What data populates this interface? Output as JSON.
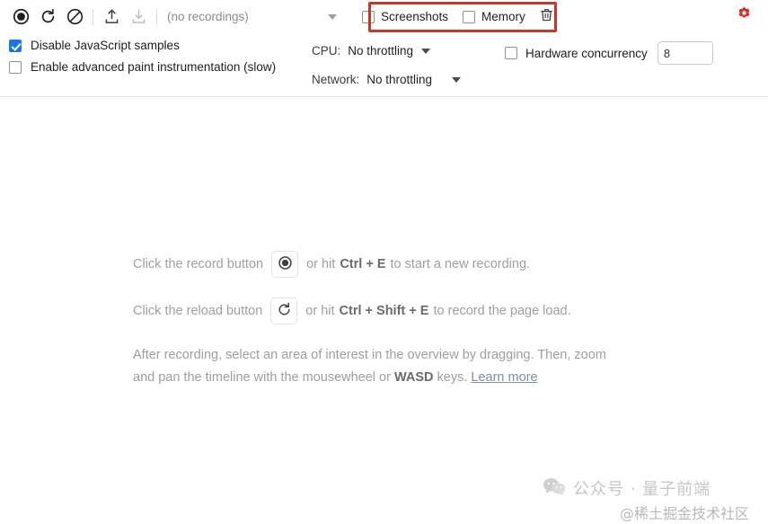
{
  "toolbar": {
    "record_icon": "record-circle-icon",
    "reload_icon": "reload-icon",
    "clear_icon": "clear-prohibited-icon",
    "upload_icon": "upload-profile-icon",
    "download_icon": "download-profile-icon",
    "recordings_select_value": "(no recordings)",
    "screenshots_label": "Screenshots",
    "screenshots_checked": false,
    "memory_label": "Memory",
    "memory_checked": false,
    "trash_icon": "trash-icon",
    "gear_icon": "gear-icon",
    "gear_color": "#d93025",
    "annotation_color": "#c0392b"
  },
  "options": {
    "disable_js_samples_label": "Disable JavaScript samples",
    "disable_js_samples_checked": true,
    "paint_instrumentation_label": "Enable advanced paint instrumentation (slow)",
    "paint_instrumentation_checked": false,
    "cpu_label": "CPU:",
    "cpu_value": "No throttling",
    "network_label": "Network:",
    "network_value": "No throttling",
    "hardware_concurrency_label": "Hardware concurrency",
    "hardware_concurrency_checked": false,
    "hardware_concurrency_value": "8",
    "accent_checkbox_color": "#1a73e8"
  },
  "main": {
    "record_hint_pre": "Click the record button",
    "record_hint_mid": "or hit",
    "record_hint_shortcut": "Ctrl + E",
    "record_hint_post": "to start a new recording.",
    "reload_hint_pre": "Click the reload button",
    "reload_hint_mid": "or hit",
    "reload_hint_shortcut": "Ctrl + Shift + E",
    "reload_hint_post": "to record the page load.",
    "overview_hint_1": "After recording, select an area of interest in the overview by dragging. Then,",
    "overview_hint_2": "zoom and pan the timeline with the mousewheel or",
    "overview_hint_keys": "WASD",
    "overview_hint_3": "keys.",
    "learn_more_label": "Learn more"
  },
  "watermark": {
    "wechat_icon": "wechat-icon",
    "line1": "公众号 · 量子前端",
    "line2": "@稀土掘金技术社区"
  }
}
